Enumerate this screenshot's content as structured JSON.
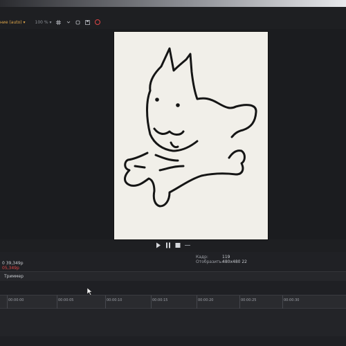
{
  "window": {
    "accent": "#e04646"
  },
  "toolbar": {
    "resolution": "ние (auto) ▾",
    "zoom": "100 % ▾",
    "icons": [
      "grid-icon",
      "chevron-down-icon",
      "link-icon",
      "save-icon",
      "record-icon"
    ]
  },
  "transport": {
    "buttons": [
      "play-icon",
      "pause-icon",
      "stop-icon",
      "more-icon"
    ]
  },
  "status": {
    "line1": "0 39,349р",
    "line2": "05,349р",
    "frame_label": "Кадр:",
    "frame_value": "119",
    "display_label": "Отобразить:",
    "display_value": "480x480 22"
  },
  "panel": {
    "tab_label": "Триммер"
  },
  "timeline": {
    "timecodes": [
      "00:00:00",
      "00:00:05",
      "00:00:10",
      "00:00:15",
      "00:00:20",
      "00:00:25",
      "00:00:30"
    ]
  }
}
